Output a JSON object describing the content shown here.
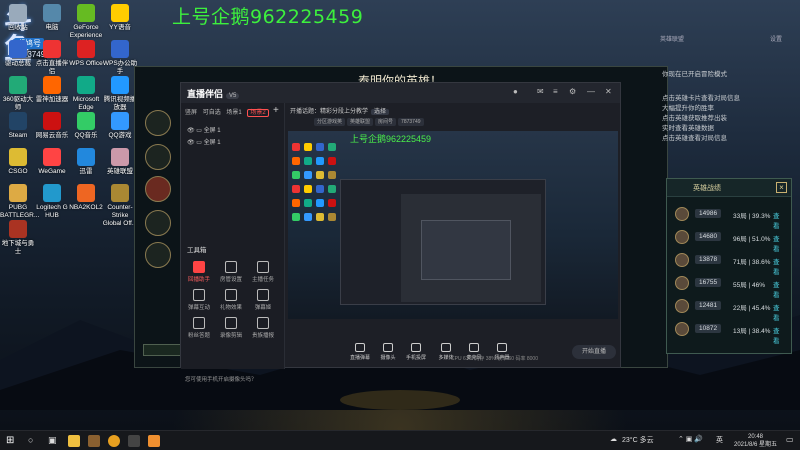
{
  "stream_overlay": {
    "title": "上号企鹅962225459",
    "logo_text": "斗鱼",
    "logo_tag": "斑鸠号",
    "logo_id": "7873749"
  },
  "desktop_icons": [
    {
      "label": "回收站",
      "icon": "recycle-bin-icon",
      "color": "#9ab"
    },
    {
      "label": "电脑",
      "icon": "computer-icon",
      "color": "#58a"
    },
    {
      "label": "GeForce Experience",
      "icon": "geforce-icon",
      "color": "#6b2"
    },
    {
      "label": "YY语音",
      "icon": "yy-icon",
      "color": "#fc0"
    },
    {
      "label": "驱动总裁",
      "icon": "driver-icon",
      "color": "#36c"
    },
    {
      "label": "点击直播伴侣",
      "icon": "live-icon",
      "color": "#e33"
    },
    {
      "label": "WPS Office",
      "icon": "wps-icon",
      "color": "#d22"
    },
    {
      "label": "WPS办公助手",
      "icon": "wps-helper-icon",
      "color": "#36c"
    },
    {
      "label": "360驱动大师",
      "icon": "driver-master-icon",
      "color": "#2a7"
    },
    {
      "label": "雷神加速器",
      "icon": "accelerator-icon",
      "color": "#f60"
    },
    {
      "label": "Microsoft Edge",
      "icon": "edge-icon",
      "color": "#1a8"
    },
    {
      "label": "腾讯视频播放器",
      "icon": "video-icon",
      "color": "#29f"
    },
    {
      "label": "Steam",
      "icon": "steam-icon",
      "color": "#246"
    },
    {
      "label": "网易云音乐",
      "icon": "music-icon",
      "color": "#c11"
    },
    {
      "label": "QQ音乐",
      "icon": "qq-music-icon",
      "color": "#3c6"
    },
    {
      "label": "QQ游戏",
      "icon": "qq-game-icon",
      "color": "#39f"
    },
    {
      "label": "CSGO",
      "icon": "csgo-icon",
      "color": "#db3"
    },
    {
      "label": "WeGame",
      "icon": "wegame-icon",
      "color": "#f44"
    },
    {
      "label": "迅雷",
      "icon": "thunder-icon",
      "color": "#28d"
    },
    {
      "label": "英雄联盟",
      "icon": "lol-icon",
      "color": "#c9a"
    },
    {
      "label": "PUBG BATTLEGR...",
      "icon": "pubg-icon",
      "color": "#da4"
    },
    {
      "label": "Logitech G HUB",
      "icon": "ghub-icon",
      "color": "#29c"
    },
    {
      "label": "NBA2KOL2",
      "icon": "nba-icon",
      "color": "#e62"
    },
    {
      "label": "Counter-Strike Global Off...",
      "icon": "cs-icon",
      "color": "#a83"
    },
    {
      "label": "地下城与勇士",
      "icon": "dnf-icon",
      "color": "#a32"
    }
  ],
  "game_client": {
    "title": "泰明你的英雄！",
    "right_text": [
      "你现在已开启冒险模式",
      "",
      "",
      "点击英雄卡片查看对局信息",
      "大幅提升你的胜率",
      "点击英雄获取推荐出装",
      "实时查看英雄数据",
      "点击英雄查看对局信息"
    ],
    "top_right_text": [
      "英雄联盟",
      "设置"
    ]
  },
  "hero_panel": {
    "title": "英雄战绩",
    "close": "×",
    "rows": [
      {
        "score": "14986",
        "rate": "33局 | 39.3%",
        "action": "查看"
      },
      {
        "score": "14680",
        "rate": "96局 | 51.0%",
        "action": "查看"
      },
      {
        "score": "13878",
        "rate": "71局 | 38.6%",
        "action": "查看"
      },
      {
        "score": "16755",
        "rate": "55局 | 46%",
        "action": "查看"
      },
      {
        "score": "12481",
        "rate": "22局 | 45.4%",
        "action": "查看"
      },
      {
        "score": "10872",
        "rate": "13局 | 38.4%",
        "action": "查看"
      }
    ]
  },
  "app": {
    "name": "直播伴侣",
    "badge": "V5",
    "scene_tabs": [
      "竖屏",
      "可自选",
      "场景1",
      "场景2"
    ],
    "active_tab": "场景2",
    "scenes": [
      "全屏 1",
      "全屏 1"
    ],
    "live_topic_label": "开播话题：",
    "live_topic": "精彩分段上分教学",
    "topic_button": "选择",
    "mini_tags": [
      "分区游戏英",
      "英雄联盟",
      "房间号",
      "7873749"
    ],
    "preview_title": "上号企鹅962225459",
    "toolbox_label": "工具箱",
    "tools": [
      {
        "label": "回播助手",
        "red": true
      },
      {
        "label": "房管设置",
        "red": false
      },
      {
        "label": "主播任务",
        "red": false
      },
      {
        "label": "弹幕互动",
        "red": false
      },
      {
        "label": "礼物效果",
        "red": false
      },
      {
        "label": "弹幕姬",
        "red": false
      },
      {
        "label": "粉丝答题",
        "red": false
      },
      {
        "label": "录像剪辑",
        "red": false
      },
      {
        "label": "贵族播报",
        "red": false
      }
    ],
    "bottom_tools": [
      "直播弹幕",
      "摄像头",
      "手机投屏",
      "多媒体",
      "麦克风",
      "扬声器"
    ],
    "start_button": "开始直播",
    "footer_note": "您可使用手机开启摄像头吗？",
    "stats": "CPU 61%  内存 38%  帧率 60  码率 8000"
  },
  "taskbar": {
    "weather": "23°C 多云",
    "time": "20:48",
    "date": "2021/8/6 星期五",
    "lang": "英"
  }
}
